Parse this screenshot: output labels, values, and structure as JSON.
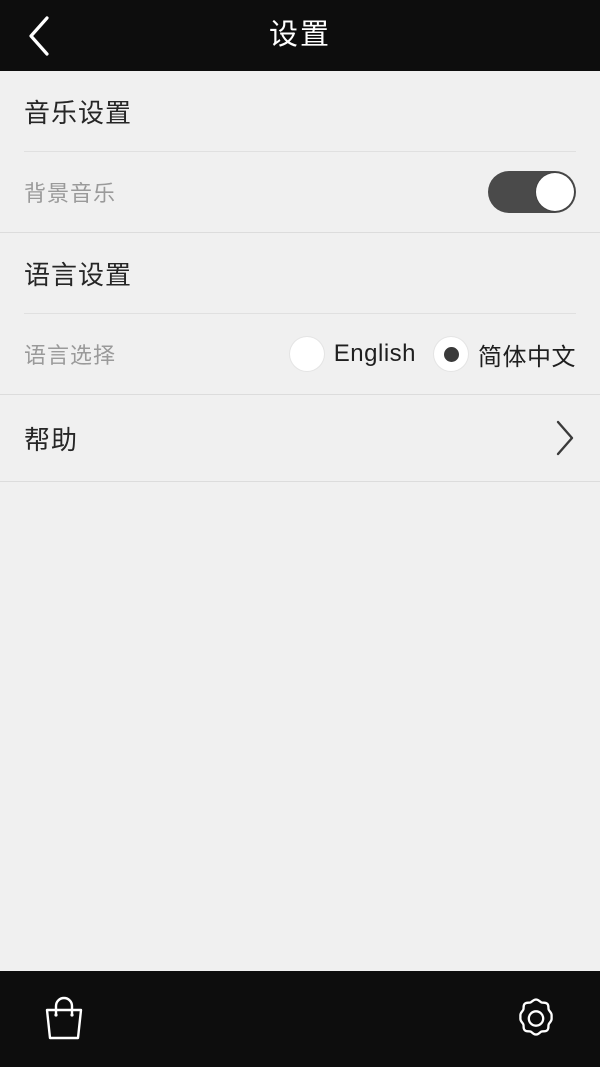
{
  "header": {
    "title": "设置",
    "back_icon": "chevron-left-icon"
  },
  "sections": {
    "music": {
      "title": "音乐设置",
      "rows": [
        {
          "label": "背景音乐",
          "control": "toggle",
          "state": "on"
        }
      ]
    },
    "language": {
      "title": "语言设置",
      "rows": [
        {
          "label": "语言选择",
          "control": "radio-group",
          "options": [
            {
              "label": "English",
              "selected": false
            },
            {
              "label": "简体中文",
              "selected": true
            }
          ]
        }
      ]
    },
    "help": {
      "title": "帮助",
      "chevron_icon": "chevron-right-icon"
    }
  },
  "bottom_nav": {
    "items": [
      {
        "name": "shop-bag-icon",
        "label": ""
      },
      {
        "name": "gear-icon",
        "label": ""
      }
    ]
  },
  "colors": {
    "page_background": "#f0f0f0",
    "bar_background": "#0d0d0d",
    "bar_text": "#ffffff",
    "section_title": "#262626",
    "row_label": "#9a9a9a",
    "divider": "#e0e0e0",
    "toggle_on_track": "#4a4a4a",
    "toggle_knob": "#ffffff",
    "radio_dot": "#3a3a3a"
  }
}
